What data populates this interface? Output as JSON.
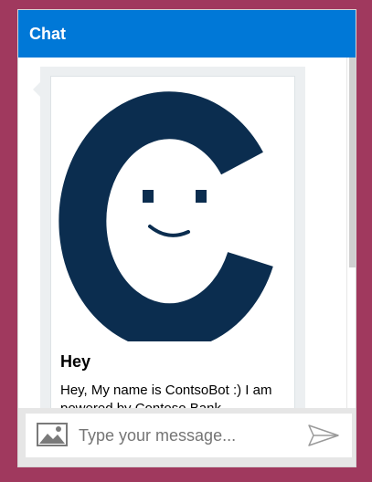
{
  "header": {
    "title": "Chat"
  },
  "card": {
    "title": "Hey",
    "text": "Hey, My name is ContsoBot :) I am powered by Contoso Bank."
  },
  "input": {
    "placeholder": "Type your message..."
  },
  "icons": {
    "attach": "image-icon",
    "send": "send-icon",
    "logo": "contoso-c-logo"
  },
  "colors": {
    "header": "#0078d7",
    "background": "#a0395e",
    "logo": "#0b2d4f"
  }
}
